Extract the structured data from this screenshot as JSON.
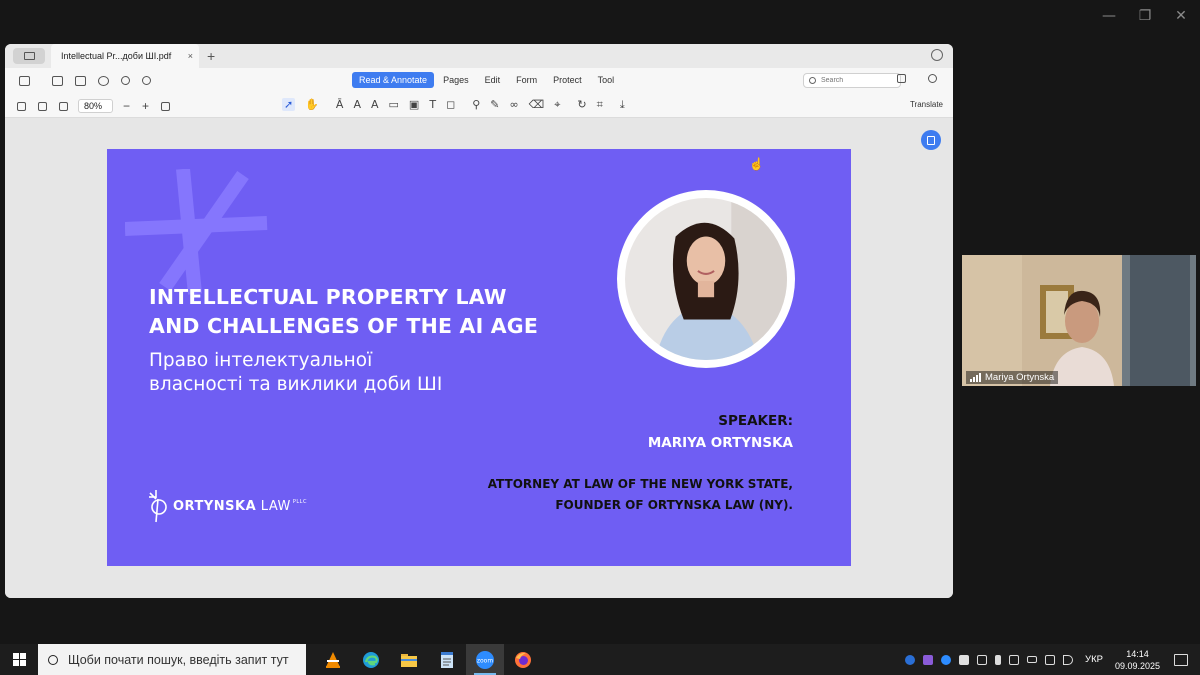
{
  "window_controls": {
    "minimize": "—",
    "restore": "❐",
    "close": "✕"
  },
  "viewer": {
    "tab_title": "Intellectual Pr...доби ШІ.pdf",
    "tab_close": "×",
    "tab_add": "+",
    "menu": [
      {
        "label": "Read & Annotate",
        "active": true
      },
      {
        "label": "Pages"
      },
      {
        "label": "Edit"
      },
      {
        "label": "Form"
      },
      {
        "label": "Protect"
      },
      {
        "label": "Tool"
      }
    ],
    "search_placeholder": "Search",
    "zoom": "80%",
    "zoom_minus": "−",
    "zoom_plus": "+",
    "translate_label": "Translate"
  },
  "slide": {
    "title_en_line1": "INTELLECTUAL PROPERTY LAW",
    "title_en_line2": "AND CHALLENGES OF THE AI AGE",
    "title_ua_line1": "Право інтелектуальної",
    "title_ua_line2": "власності та виклики доби ШІ",
    "speaker_label": "SPEAKER:",
    "speaker_name": "MARIYA ORTYNSKA",
    "attorney_line1": "ATTORNEY AT LAW OF THE NEW YORK STATE,",
    "attorney_line2": "FOUNDER OF ORTYNSKA LAW (NY).",
    "logo_text_a": "ORTYNSKA",
    "logo_text_b": "LAW",
    "logo_suffix": "PLLC",
    "bg_color": "#6f5ef3"
  },
  "webcam": {
    "participant_name": "Mariya Ortynska"
  },
  "taskbar": {
    "search_placeholder": "Щоби почати пошук, введіть запит тут",
    "apps": [
      "vlc-icon",
      "edge-icon",
      "file-explorer-icon",
      "notepad-icon",
      "zoom-icon",
      "firefox-icon"
    ],
    "language": "УКР",
    "time": "14:14",
    "date": "09.09.2025"
  }
}
